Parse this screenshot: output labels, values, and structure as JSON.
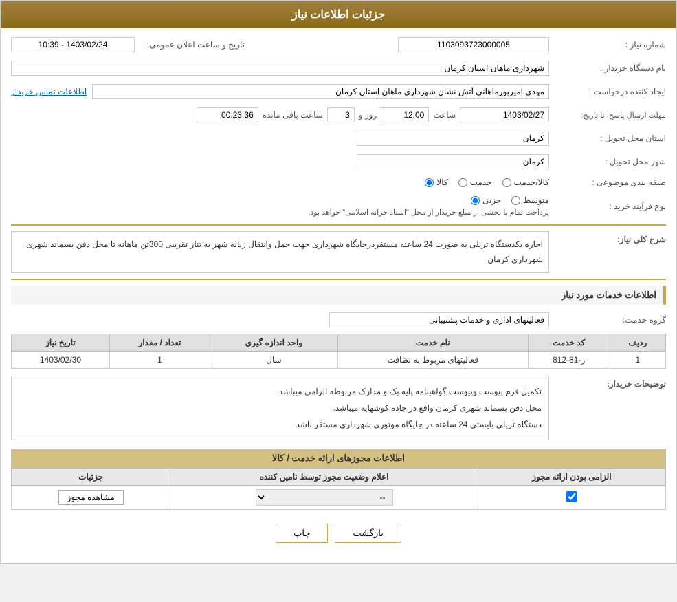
{
  "header": {
    "title": "جزئیات اطلاعات نیاز"
  },
  "fields": {
    "need_number_label": "شماره نیاز :",
    "need_number_value": "1103093723000005",
    "buyer_name_label": "نام دستگاه خریدار :",
    "buyer_name_value": "شهرداری ماهان استان کرمان",
    "creator_label": "ایجاد کننده درخواست :",
    "creator_value": "مهدی امیرپورماهانی آتش نشان شهرداری ماهان استان کرمان",
    "contact_link": "اطلاعات تماس خریدار",
    "response_deadline_label": "مهلت ارسال پاسخ: تا تاریخ:",
    "date_value": "1403/02/27",
    "time_label": "ساعت",
    "time_value": "12:00",
    "day_label": "روز و",
    "day_value": "3",
    "countdown_label": "ساعت باقی مانده",
    "countdown_value": "00:23:36",
    "announce_datetime_label": "تاریخ و ساعت اعلان عمومی:",
    "announce_datetime_value": "1403/02/24 - 10:39",
    "province_label": "استان محل تحویل :",
    "province_value": "کرمان",
    "city_label": "شهر محل تحویل :",
    "city_value": "کرمان",
    "category_label": "طبقه بندی موضوعی :",
    "category_kala": "کالا",
    "category_khadamat": "خدمت",
    "category_kala_khadamat": "کالا/خدمت",
    "process_label": "نوع فرآیند خرید :",
    "process_jazzi": "جزیی",
    "process_motavasset": "متوسط",
    "process_note": "پرداخت تمام یا بخشی از مبلغ خریدار از محل \"اسناد خزانه اسلامی\" خواهد بود."
  },
  "description": {
    "section_title": "شرح کلی نیاز:",
    "text": "اجاره یکدستگاه تریلی به صورت 24 ساعته مستقردرجایگاه شهرداری جهت حمل وانتقال زباله شهر به تناز تقریبی 300تن ماهانه تا محل دفن بسماند شهری شهرداری کرمان"
  },
  "services": {
    "section_title": "اطلاعات خدمات مورد نیاز",
    "group_label": "گروه خدمت:",
    "group_value": "فعالیتهای اداری و خدمات پشتیبانی",
    "table": {
      "headers": [
        "ردیف",
        "کد خدمت",
        "نام خدمت",
        "واحد اندازه گیری",
        "تعداد / مقدار",
        "تاریخ نیاز"
      ],
      "rows": [
        {
          "row": "1",
          "code": "ز-81-812",
          "name": "فعالیتهای مربوط به نظافت",
          "unit": "سال",
          "quantity": "1",
          "date": "1403/02/30"
        }
      ]
    }
  },
  "buyer_notes": {
    "label": "توضیحات خریدار:",
    "line1": "تکمیل فرم پیوست وپیوست گواهینامه پایه یک و مدارک مربوطه الزامی میباشد.",
    "line2": "محل دفن بسماند شهری کرمان واقع در جاده کوشهایه میباشد.",
    "line3": "دستگاه تریلی بایستی 24 ساعته در جایگاه موتوری شهرداری مستقر باشد"
  },
  "permits": {
    "section_header": "اطلاعات مجوزهای ارائه خدمت / کالا",
    "table": {
      "headers": [
        "الزامی بودن ارائه مجوز",
        "اعلام وضعیت مجوز توسط نامین کننده",
        "جزئیات"
      ],
      "row": {
        "required": true,
        "status": "--",
        "detail_btn": "مشاهده مجوز"
      }
    }
  },
  "actions": {
    "print_label": "چاپ",
    "back_label": "بازگشت"
  }
}
